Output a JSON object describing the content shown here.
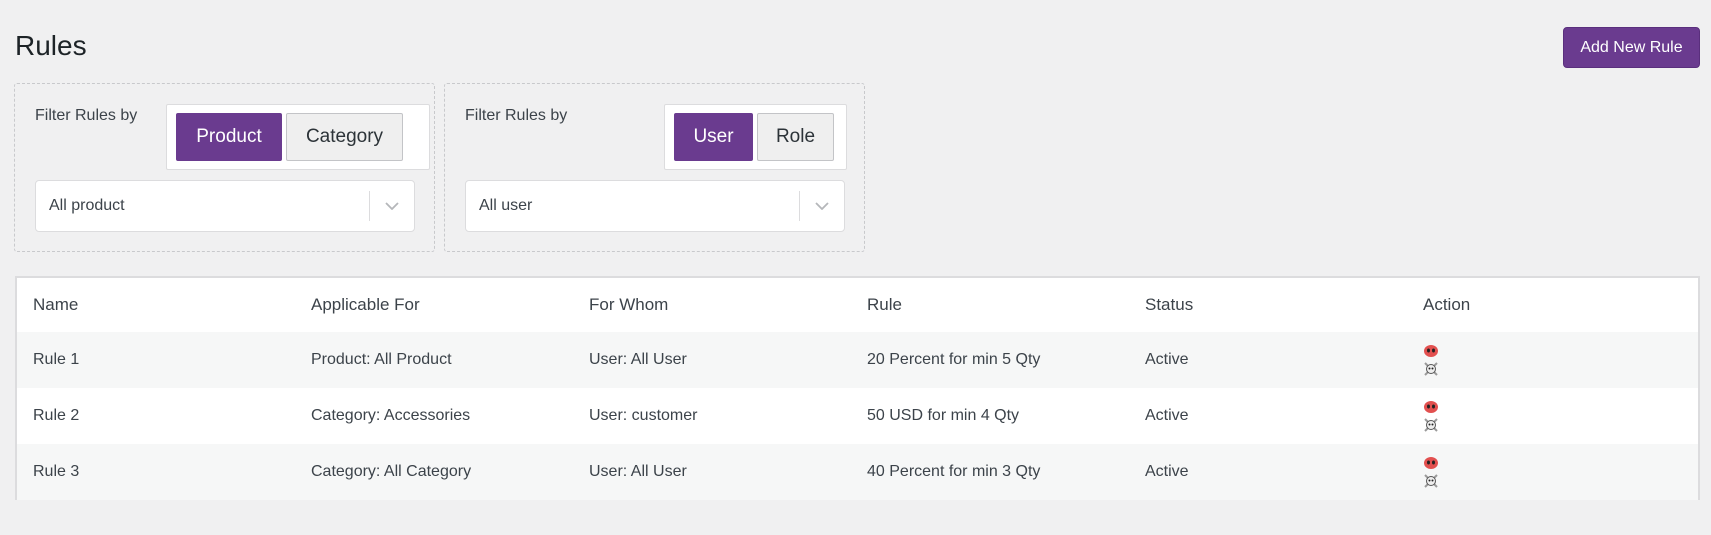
{
  "header": {
    "title": "Rules",
    "add_button": "Add New Rule"
  },
  "filters": [
    {
      "label": "Filter Rules by",
      "toggles": [
        {
          "label": "Product",
          "active": true
        },
        {
          "label": "Category",
          "active": false
        }
      ],
      "select_value": "All product"
    },
    {
      "label": "Filter Rules by",
      "toggles": [
        {
          "label": "User",
          "active": true
        },
        {
          "label": "Role",
          "active": false
        }
      ],
      "select_value": "All user"
    }
  ],
  "table": {
    "columns": [
      "Name",
      "Applicable For",
      "For Whom",
      "Rule",
      "Status",
      "Action"
    ],
    "rows": [
      {
        "name": "Rule 1",
        "applicable_for": "Product: All Product",
        "for_whom": "User: All User",
        "rule": "20 Percent for min 5 Qty",
        "status": "Active",
        "actions": [
          "edit-icon",
          "delete-icon"
        ]
      },
      {
        "name": "Rule 2",
        "applicable_for": "Category: Accessories",
        "for_whom": "User: customer",
        "rule": "50 USD for min 4 Qty",
        "status": "Active",
        "actions": [
          "edit-icon",
          "delete-icon"
        ]
      },
      {
        "name": "Rule 3",
        "applicable_for": "Category: All Category",
        "for_whom": "User: All User",
        "rule": "40 Percent for min 3 Qty",
        "status": "Active",
        "actions": [
          "edit-icon",
          "delete-icon"
        ]
      }
    ]
  },
  "colors": {
    "accent": "#6a3b8f",
    "background": "#f0f0f1"
  }
}
